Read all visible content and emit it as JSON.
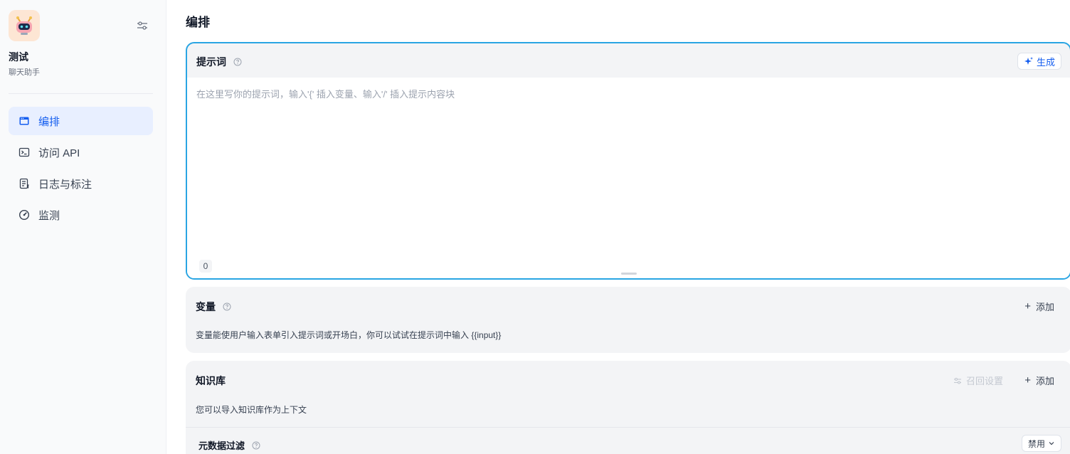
{
  "sidebar": {
    "app_name": "测试",
    "app_type": "聊天助手",
    "avatar_icon": "robot-icon",
    "settings_icon": "settings-sliders-icon",
    "nav": [
      {
        "label": "编排",
        "icon": "layout-icon",
        "active": true
      },
      {
        "label": "访问 API",
        "icon": "terminal-icon",
        "active": false
      },
      {
        "label": "日志与标注",
        "icon": "file-list-icon",
        "active": false
      },
      {
        "label": "监测",
        "icon": "gauge-icon",
        "active": false
      }
    ]
  },
  "main": {
    "title": "编排",
    "prompt": {
      "label": "提示词",
      "generate_label": "生成",
      "placeholder": "在这里写你的提示词，输入'{' 插入变量、输入'/' 插入提示内容块",
      "value": "",
      "char_count": "0"
    },
    "variables": {
      "label": "变量",
      "add_label": "添加",
      "description": "变量能使用户输入表单引入提示词或开场白，你可以试试在提示词中输入 {{input}}"
    },
    "knowledge": {
      "label": "知识库",
      "recall_label": "召回设置",
      "add_label": "添加",
      "description": "您可以导入知识库作为上下文",
      "metadata_filter_label": "元数据过滤",
      "metadata_filter_value": "禁用"
    }
  },
  "colors": {
    "accent": "#155eef",
    "active_nav_bg": "#e8efff",
    "prompt_border": "#2aa5e3",
    "card_bg": "#f3f4f6"
  }
}
